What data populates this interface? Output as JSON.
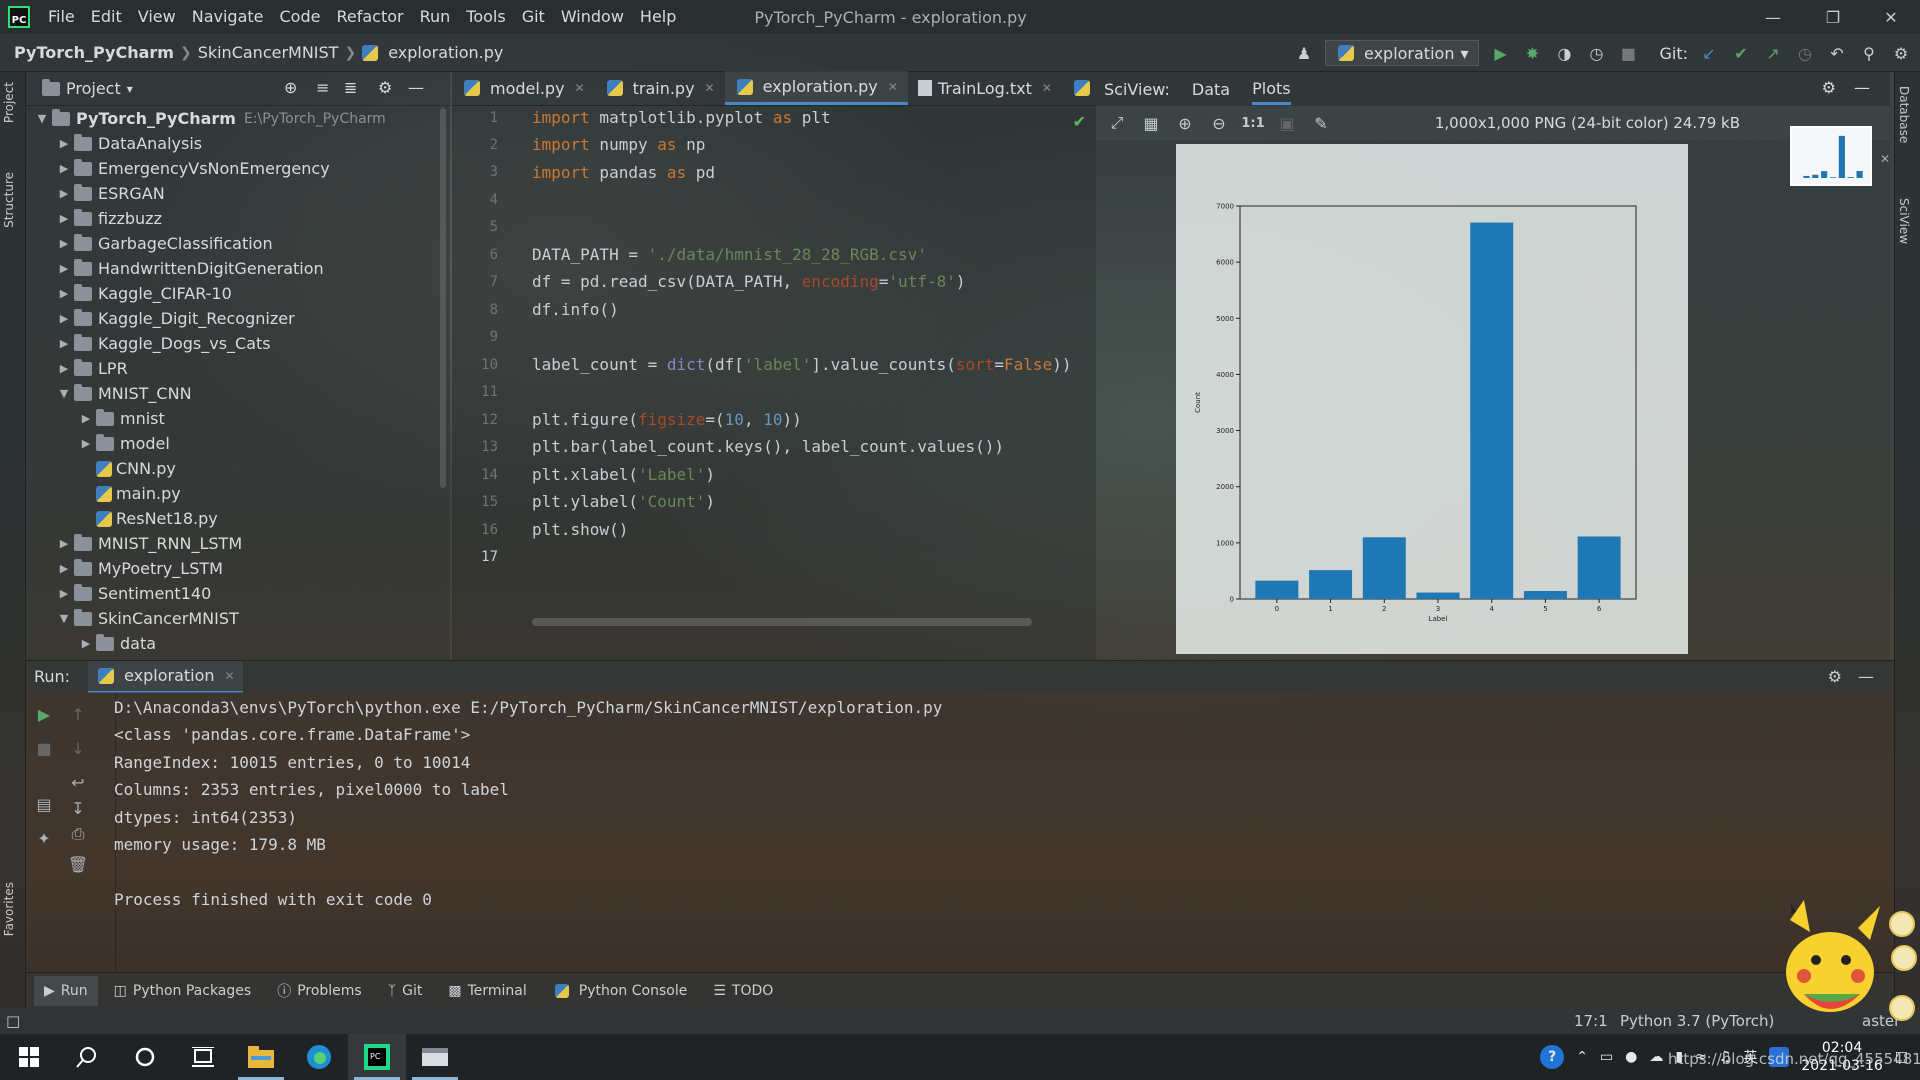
{
  "window": {
    "title": "PyTorch_PyCharm - exploration.py",
    "logo": "PC",
    "menu": [
      "File",
      "Edit",
      "View",
      "Navigate",
      "Code",
      "Refactor",
      "Run",
      "Tools",
      "Git",
      "Window",
      "Help"
    ]
  },
  "breadcrumb": [
    "PyTorch_PyCharm",
    "SkinCancerMNIST",
    "exploration.py"
  ],
  "toolbar": {
    "run_config": "exploration",
    "git_label": "Git:"
  },
  "project": {
    "title": "Project",
    "root_name": "PyTorch_PyCharm",
    "root_path": "E:\\PyTorch_PyCharm",
    "folders": [
      "DataAnalysis",
      "EmergencyVsNonEmergency",
      "ESRGAN",
      "fizzbuzz",
      "GarbageClassification",
      "HandwrittenDigitGeneration",
      "Kaggle_CIFAR-10",
      "Kaggle_Digit_Recognizer",
      "Kaggle_Dogs_vs_Cats",
      "LPR",
      "MNIST_CNN"
    ],
    "mnist_cnn_children": [
      "mnist",
      "model",
      "CNN.py",
      "main.py",
      "ResNet18.py"
    ],
    "more_folders": [
      "MNIST_RNN_LSTM",
      "MyPoetry_LSTM",
      "Sentiment140",
      "SkinCancerMNIST"
    ],
    "skin_children": [
      "data"
    ]
  },
  "left_stripe": {
    "project": "Project",
    "structure": "Structure",
    "favorites": "Favorites"
  },
  "right_stripe": {
    "database": "Database",
    "sciview": "SciView"
  },
  "editor": {
    "tabs": [
      "model.py",
      "train.py",
      "exploration.py",
      "TrainLog.txt"
    ],
    "line_numbers": [
      "1",
      "2",
      "3",
      "4",
      "5",
      "6",
      "7",
      "8",
      "9",
      "10",
      "11",
      "12",
      "13",
      "14",
      "15",
      "16",
      "17"
    ],
    "code": {
      "l1_kw": "import",
      "l1_rest": " matplotlib.pyplot ",
      "l1_as": "as",
      "l1_alias": " plt",
      "l2_kw": "import",
      "l2_rest": " numpy ",
      "l2_as": "as",
      "l2_alias": " np",
      "l3_kw": "import",
      "l3_rest": " pandas ",
      "l3_as": "as",
      "l3_alias": " pd",
      "l6_a": "DATA_PATH = ",
      "l6_str": "'./data/hmnist_28_28_RGB.csv'",
      "l7_a": "df = pd.read_csv(DATA_PATH, ",
      "l7_prm": "encoding",
      "l7_b": "=",
      "l7_str": "'utf-8'",
      "l7_c": ")",
      "l8": "df.info()",
      "l10_a": "label_count = ",
      "l10_bi": "dict",
      "l10_b": "(df[",
      "l10_str": "'label'",
      "l10_c": "].value_counts(",
      "l10_prm": "sort",
      "l10_d": "=",
      "l10_kw": "False",
      "l10_e": "))",
      "l12_a": "plt.figure(",
      "l12_prm": "figsize",
      "l12_b": "=(",
      "l12_n1": "10",
      "l12_c": ", ",
      "l12_n2": "10",
      "l12_d": "))",
      "l13": "plt.bar(label_count.keys(), label_count.values())",
      "l14_a": "plt.xlabel(",
      "l14_str": "'Label'",
      "l14_b": ")",
      "l15_a": "plt.ylabel(",
      "l15_str": "'Count'",
      "l15_b": ")",
      "l16": "plt.show()"
    }
  },
  "sciview": {
    "title": "SciView:",
    "tabs": [
      "Data",
      "Plots"
    ],
    "zoom_actual": "1:1",
    "image_info": "1,000x1,000 PNG (24-bit color) 24.79 kB"
  },
  "chart_data": {
    "type": "bar",
    "categories": [
      "0",
      "1",
      "2",
      "3",
      "4",
      "5",
      "6"
    ],
    "values": [
      327,
      514,
      1099,
      115,
      6705,
      142,
      1113
    ],
    "xlabel": "Label",
    "ylabel": "Count",
    "ylim": [
      0,
      7000
    ],
    "yticks": [
      "0",
      "1000",
      "2000",
      "3000",
      "4000",
      "5000",
      "6000",
      "7000"
    ],
    "bar_color": "#1f77b4"
  },
  "run": {
    "label": "Run:",
    "tab": "exploration",
    "console": [
      "D:\\Anaconda3\\envs\\PyTorch\\python.exe E:/PyTorch_PyCharm/SkinCancerMNIST/exploration.py",
      "<class 'pandas.core.frame.DataFrame'>",
      "RangeIndex: 10015 entries, 0 to 10014",
      "Columns: 2353 entries, pixel0000 to label",
      "dtypes: int64(2353)",
      "memory usage: 179.8 MB",
      "",
      "Process finished with exit code 0"
    ]
  },
  "tool_windows": [
    "Run",
    "Python Packages",
    "Problems",
    "Git",
    "Terminal",
    "Python Console",
    "TODO"
  ],
  "status": {
    "position": "17:1",
    "interpreter": "Python 3.7 (PyTorch)",
    "branch": "aster"
  },
  "taskbar": {
    "time": "02:04",
    "date": "2021-03-16",
    "ime": "英",
    "watermark": "https://blog.csdn.net/qq_45554810"
  },
  "colors": {
    "accent": "#4a88c7",
    "run_green": "#59a869",
    "bar": "#1f77b4"
  }
}
